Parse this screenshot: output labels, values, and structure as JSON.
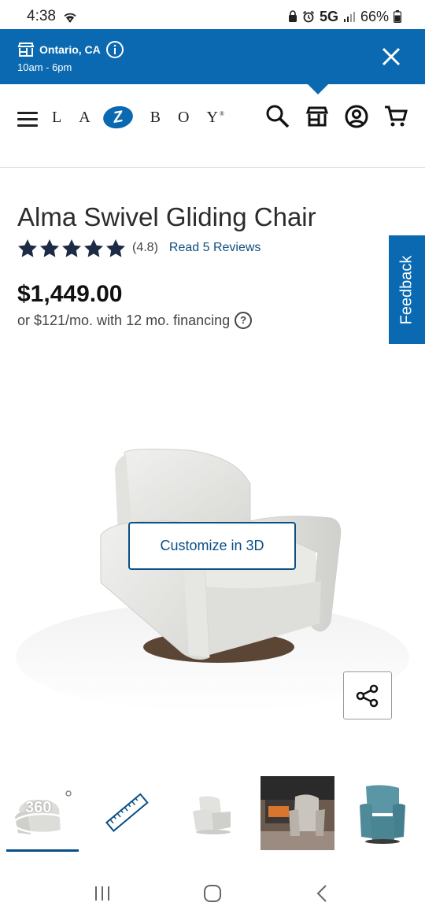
{
  "status": {
    "time": "4:38",
    "network": "5G",
    "battery": "66%"
  },
  "store": {
    "location": "Ontario, CA",
    "hours": "10am - 6pm"
  },
  "header": {
    "logo_letters": [
      "L",
      "A",
      "Z",
      "B",
      "O",
      "Y"
    ],
    "logo_tm": "®"
  },
  "product": {
    "title": "Alma Swivel Gliding Chair",
    "rating": "(4.8)",
    "rating_value": 4.8,
    "stars_filled": 5,
    "reviews_link": "Read 5 Reviews",
    "price": "$1,449.00",
    "financing": "or $121/mo. with 12 mo. financing",
    "help_symbol": "?"
  },
  "buttons": {
    "customize": "Customize in 3D",
    "feedback": "Feedback"
  },
  "thumbnails": [
    {
      "label": "360",
      "kind": "360-view"
    },
    {
      "label": "",
      "kind": "ruler-dimensions"
    },
    {
      "label": "",
      "kind": "chair-side"
    },
    {
      "label": "",
      "kind": "chair-room"
    },
    {
      "label": "",
      "kind": "chair-teal"
    }
  ],
  "colors": {
    "brand_blue": "#0a69b0",
    "link_blue": "#0a4f85",
    "chair_fabric": "#e8e8e6",
    "teal_fabric": "#4f8a99"
  },
  "icons": [
    "wifi-icon",
    "store-icon",
    "info-icon",
    "close-icon",
    "menu-icon",
    "search-icon",
    "account-icon",
    "cart-icon",
    "share-icon"
  ]
}
